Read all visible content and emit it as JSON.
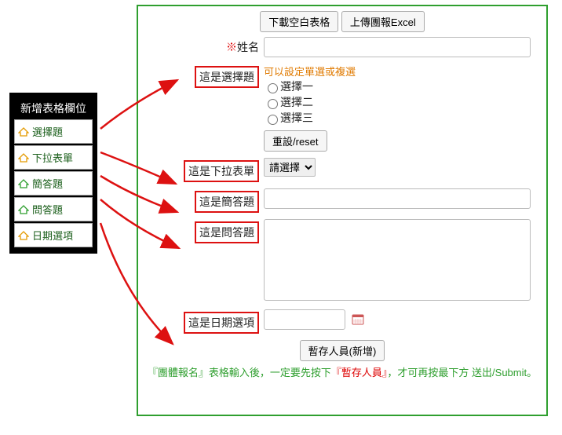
{
  "sidebar": {
    "title": "新增表格欄位",
    "items": [
      {
        "label": "選擇題"
      },
      {
        "label": "下拉表單"
      },
      {
        "label": "簡答題"
      },
      {
        "label": "問答題"
      },
      {
        "label": "日期選項"
      }
    ]
  },
  "form": {
    "btn_download": "下載空白表格",
    "btn_upload": "上傳團報Excel",
    "name_label": "姓名",
    "required_mark": "※",
    "choice_label": "這是選擇題",
    "choice_hint": "可以設定單選或複選",
    "choice_opts": [
      "選擇一",
      "選擇二",
      "選擇三"
    ],
    "reset_btn": "重設/reset",
    "dropdown_label": "這是下拉表單",
    "dropdown_placeholder": "請選擇",
    "short_label": "這是簡答題",
    "essay_label": "這是問答題",
    "date_label": "這是日期選項",
    "save_btn": "暫存人員(新增)",
    "note_a": "『團體報名』表格輸入後，一定要先按下",
    "note_b": "『暫存人員』",
    "note_c": "，才可再按最下方 送出/Submit。"
  }
}
